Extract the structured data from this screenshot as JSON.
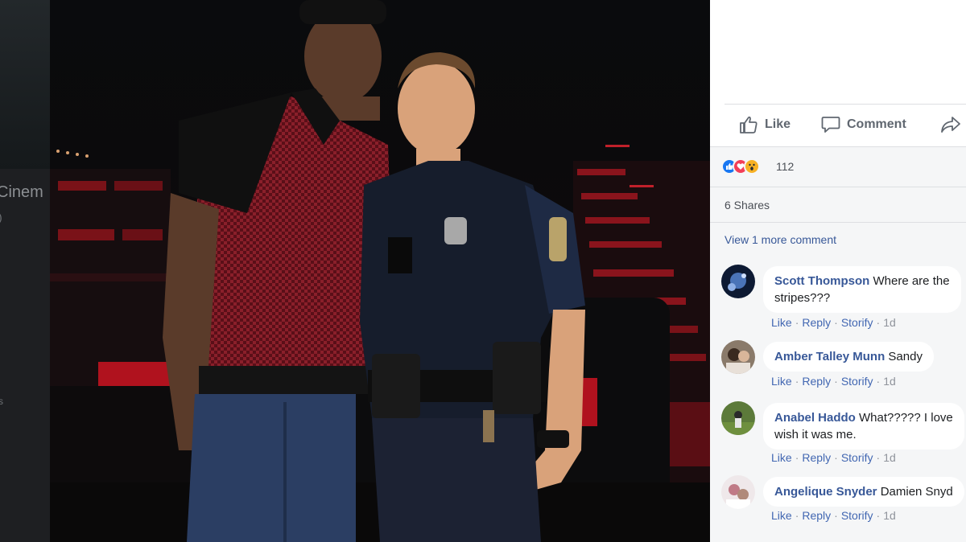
{
  "left_strip": {
    "partial_label": "Cinem",
    "paren": ")",
    "letter": "s"
  },
  "actions": [
    {
      "label": "Like",
      "icon": "thumbs-up-icon"
    },
    {
      "label": "Comment",
      "icon": "comment-icon"
    }
  ],
  "reactions": {
    "icons": [
      "like-reaction-icon",
      "love-reaction-icon",
      "wow-reaction-icon"
    ],
    "count": "112"
  },
  "shares": "6 Shares",
  "view_more": "View 1 more comment",
  "comment_meta": {
    "like": "Like",
    "reply": "Reply",
    "storify": "Storify",
    "sep": "·",
    "time": "1d"
  },
  "comments": [
    {
      "author": "Scott Thompson",
      "line1": " Where are the",
      "line2": "stripes???"
    },
    {
      "author": "Amber Talley Munn",
      "line1": " Sandy",
      "line2": ""
    },
    {
      "author": "Anabel Haddo",
      "line1": " What????? I love",
      "line2": "wish it was me."
    },
    {
      "author": "Angelique Snyder",
      "line1": " Damien Snyd",
      "line2": ""
    }
  ],
  "colors": {
    "link_blue": "#385898",
    "like_blue": "#1877f2",
    "love_red": "#f33e58",
    "wow_yellow": "#f7b125"
  }
}
